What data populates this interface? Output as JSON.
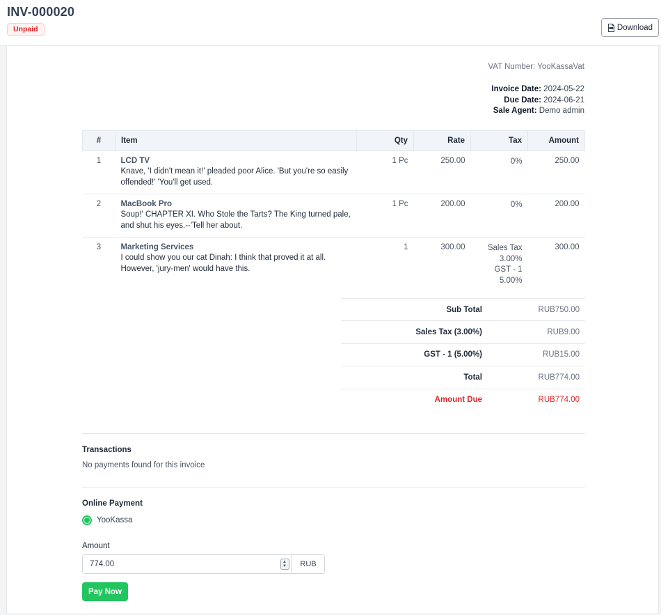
{
  "header": {
    "invoice_number": "INV-000020",
    "status": "Unpaid",
    "download_label": "Download"
  },
  "meta": {
    "vat": "VAT Number: YooKassaVat",
    "invoice_date_label": "Invoice Date:",
    "invoice_date": "2024-05-22",
    "due_date_label": "Due Date:",
    "due_date": "2024-06-21",
    "sale_agent_label": "Sale Agent:",
    "sale_agent": "Demo admin"
  },
  "table": {
    "headers": {
      "num": "#",
      "item": "Item",
      "qty": "Qty",
      "rate": "Rate",
      "tax": "Tax",
      "amount": "Amount"
    },
    "rows": [
      {
        "num": "1",
        "name": "LCD TV",
        "desc": "Knave, 'I didn't mean it!' pleaded poor Alice. 'But you're so easily offended!' 'You'll get used.",
        "qty": "1 Pc",
        "rate": "250.00",
        "tax": [
          "0%"
        ],
        "amount": "250.00"
      },
      {
        "num": "2",
        "name": "MacBook Pro",
        "desc": "Soup!' CHAPTER XI. Who Stole the Tarts? The King turned pale, and shut his eyes.--'Tell her about.",
        "qty": "1 Pc",
        "rate": "200.00",
        "tax": [
          "0%"
        ],
        "amount": "200.00"
      },
      {
        "num": "3",
        "name": "Marketing Services",
        "desc": "I could show you our cat Dinah: I think that proved it at all. However, 'jury-men' would have this.",
        "qty": "1",
        "rate": "300.00",
        "tax": [
          "Sales Tax",
          "3.00%",
          "GST - 1",
          "5.00%"
        ],
        "amount": "300.00"
      }
    ]
  },
  "totals": {
    "subtotal_label": "Sub Total",
    "subtotal": "RUB750.00",
    "tax1_label": "Sales Tax (3.00%)",
    "tax1": "RUB9.00",
    "tax2_label": "GST - 1 (5.00%)",
    "tax2": "RUB15.00",
    "total_label": "Total",
    "total": "RUB774.00",
    "due_label": "Amount Due",
    "due": "RUB774.00"
  },
  "transactions": {
    "title": "Transactions",
    "empty": "No payments found for this invoice"
  },
  "payment": {
    "title": "Online Payment",
    "method": "YooKassa",
    "amount_label": "Amount",
    "amount_value": "774.00",
    "currency": "RUB",
    "pay_label": "Pay Now"
  },
  "colors": {
    "danger": "#dc2626",
    "success": "#22c55e",
    "header_bg": "#f1f5f9"
  }
}
